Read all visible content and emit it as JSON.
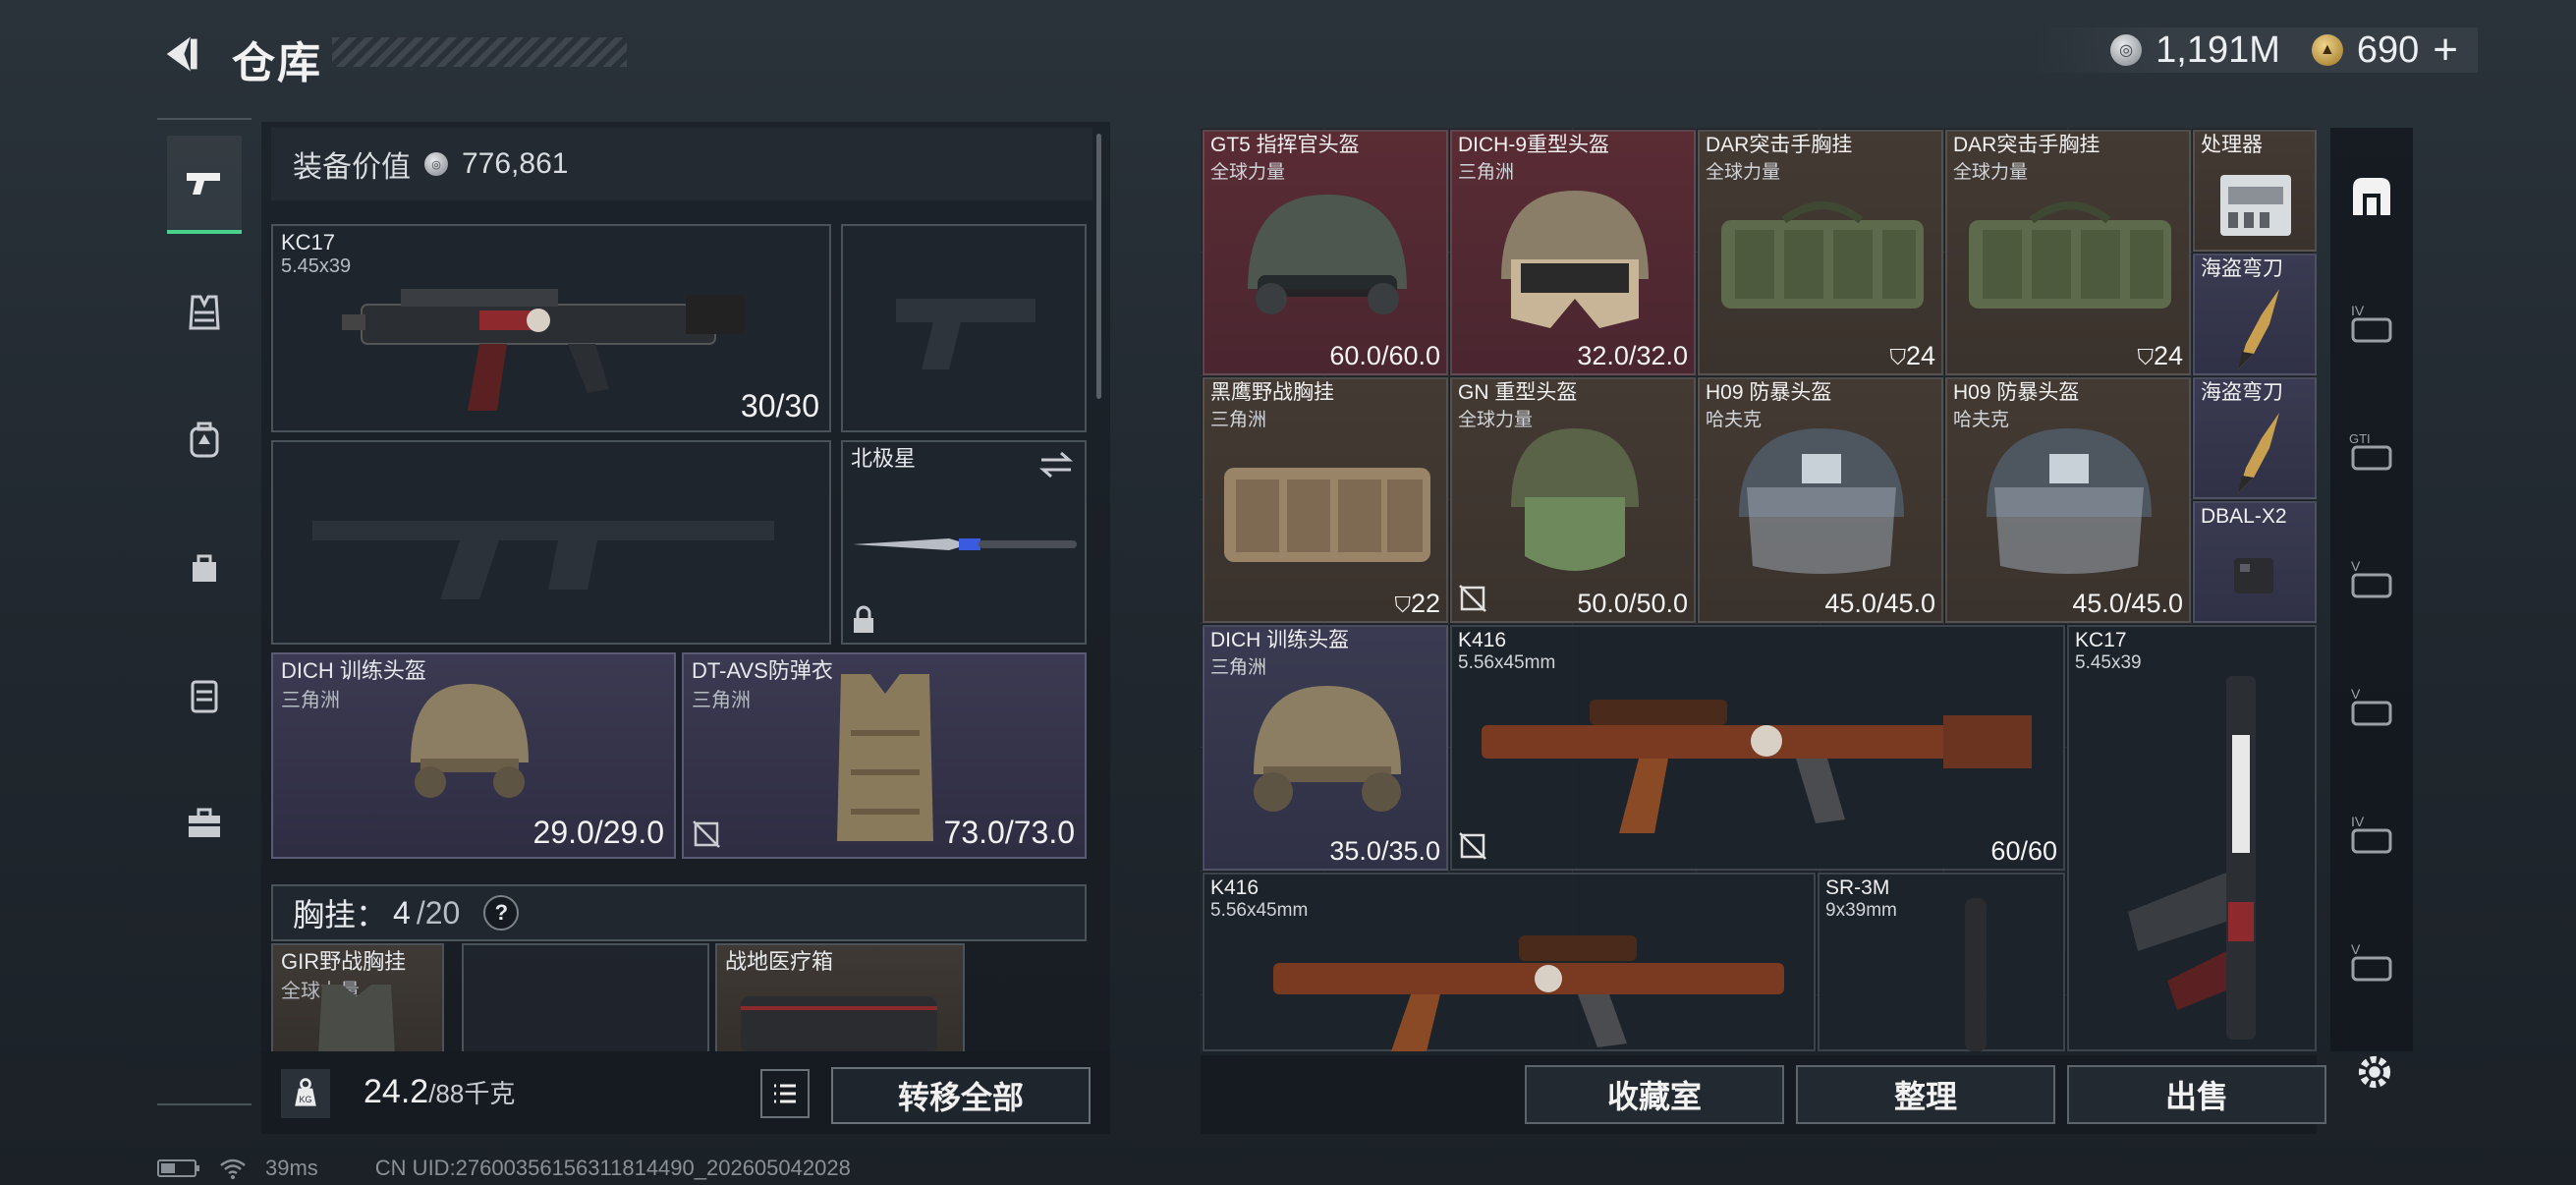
{
  "header": {
    "title": "仓库"
  },
  "currency": {
    "silver": "1,191M",
    "gold": "690",
    "plus": "+"
  },
  "loadout": {
    "equipment_value_label": "装备价值",
    "equipment_value": "776,861",
    "primary": {
      "name": "KC17",
      "caliber": "5.45x39",
      "ammo": "30/30"
    },
    "melee": {
      "name": "北极星"
    },
    "helmet": {
      "name": "DICH 训练头盔",
      "source": "三角洲",
      "durability": "29.0/29.0"
    },
    "armor": {
      "name": "DT-AVS防弹衣",
      "source": "三角洲",
      "durability": "73.0/73.0"
    },
    "chest_rig": {
      "label": "胸挂：",
      "count": "4",
      "capacity": "/20",
      "help": "?"
    },
    "chest_items": [
      {
        "name": "GIR野战胸挂",
        "source": "全球力量"
      },
      {
        "name": "",
        "source": ""
      },
      {
        "name": "战地医疗箱",
        "source": ""
      }
    ],
    "weight": {
      "current": "24.2",
      "max": "/88千克"
    },
    "transfer_all": "转移全部"
  },
  "warehouse": {
    "items": [
      {
        "name": "GT5 指挥官头盔",
        "source": "全球力量",
        "value": "60.0/60.0"
      },
      {
        "name": "DICH-9重型头盔",
        "source": "三角洲",
        "value": "32.0/32.0"
      },
      {
        "name": "DAR突击手胸挂",
        "source": "全球力量",
        "value": "24"
      },
      {
        "name": "DAR突击手胸挂",
        "source": "全球力量",
        "value": "24"
      },
      {
        "name": "处理器",
        "source": "",
        "value": ""
      },
      {
        "name": "海盗弯刀",
        "source": "",
        "value": ""
      },
      {
        "name": "黑鹰野战胸挂",
        "source": "三角洲",
        "value": "22"
      },
      {
        "name": "GN 重型头盔",
        "source": "全球力量",
        "value": "50.0/50.0"
      },
      {
        "name": "H09 防暴头盔",
        "source": "哈夫克",
        "value": "45.0/45.0"
      },
      {
        "name": "H09 防暴头盔",
        "source": "哈夫克",
        "value": "45.0/45.0"
      },
      {
        "name": "海盗弯刀",
        "source": "",
        "value": ""
      },
      {
        "name": "DBAL-X2",
        "source": "",
        "value": ""
      },
      {
        "name": "DICH 训练头盔",
        "source": "三角洲",
        "value": "35.0/35.0"
      },
      {
        "name": "K416",
        "source": "5.56x45mm",
        "value": "60/60"
      },
      {
        "name": "KC17",
        "source": "5.45x39",
        "value": ""
      },
      {
        "name": "K416",
        "source": "5.56x45mm",
        "value": ""
      },
      {
        "name": "SR-3M",
        "source": "9x39mm",
        "value": ""
      }
    ],
    "actions": {
      "collection": "收藏室",
      "sort": "整理",
      "sell": "出售"
    }
  },
  "status_bar": {
    "ping": "39ms",
    "uid": "CN UID:276003561563118144​90_202605042028"
  },
  "colors": {
    "accent": "#4bd28a",
    "red_rarity": "#5a2c34",
    "gold_rarity": "#433a33",
    "purple_rarity": "#3a3b52"
  }
}
